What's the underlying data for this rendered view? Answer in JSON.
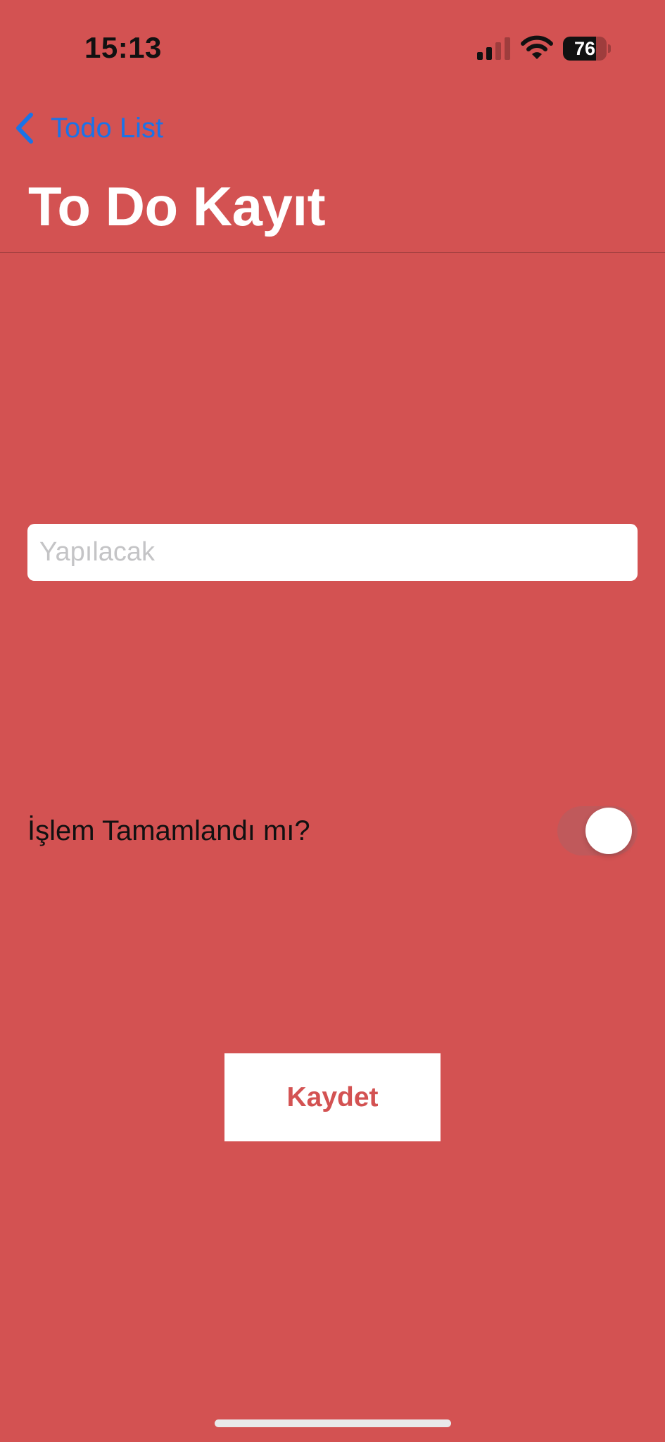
{
  "status_bar": {
    "time": "15:13",
    "battery_level": 76,
    "battery_text": "76"
  },
  "nav": {
    "back_label": "Todo List",
    "title": "To Do Kayıt"
  },
  "form": {
    "todo_placeholder": "Yapılacak",
    "todo_value": "",
    "completed_label": "İşlem Tamamlandı mı?",
    "completed_on": false,
    "save_label": "Kaydet"
  },
  "colors": {
    "background": "#d35252",
    "accent_link": "#1a73e8",
    "button_text": "#d35252"
  }
}
